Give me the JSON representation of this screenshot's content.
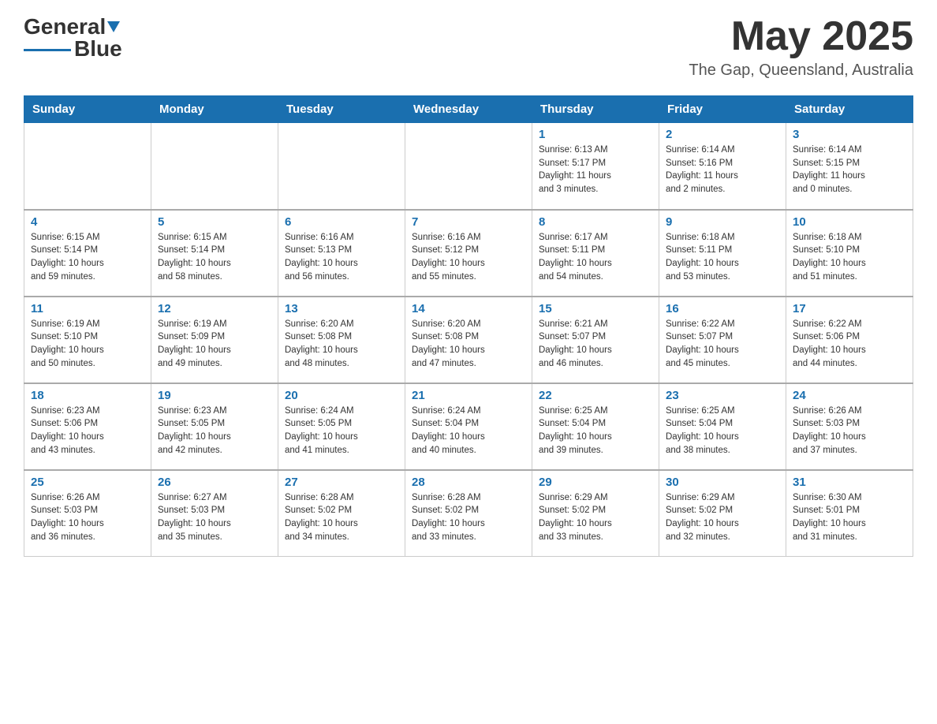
{
  "header": {
    "logo_text1": "General",
    "logo_text2": "Blue",
    "month": "May 2025",
    "location": "The Gap, Queensland, Australia"
  },
  "weekdays": [
    "Sunday",
    "Monday",
    "Tuesday",
    "Wednesday",
    "Thursday",
    "Friday",
    "Saturday"
  ],
  "weeks": [
    [
      {
        "day": "",
        "info": ""
      },
      {
        "day": "",
        "info": ""
      },
      {
        "day": "",
        "info": ""
      },
      {
        "day": "",
        "info": ""
      },
      {
        "day": "1",
        "info": "Sunrise: 6:13 AM\nSunset: 5:17 PM\nDaylight: 11 hours\nand 3 minutes."
      },
      {
        "day": "2",
        "info": "Sunrise: 6:14 AM\nSunset: 5:16 PM\nDaylight: 11 hours\nand 2 minutes."
      },
      {
        "day": "3",
        "info": "Sunrise: 6:14 AM\nSunset: 5:15 PM\nDaylight: 11 hours\nand 0 minutes."
      }
    ],
    [
      {
        "day": "4",
        "info": "Sunrise: 6:15 AM\nSunset: 5:14 PM\nDaylight: 10 hours\nand 59 minutes."
      },
      {
        "day": "5",
        "info": "Sunrise: 6:15 AM\nSunset: 5:14 PM\nDaylight: 10 hours\nand 58 minutes."
      },
      {
        "day": "6",
        "info": "Sunrise: 6:16 AM\nSunset: 5:13 PM\nDaylight: 10 hours\nand 56 minutes."
      },
      {
        "day": "7",
        "info": "Sunrise: 6:16 AM\nSunset: 5:12 PM\nDaylight: 10 hours\nand 55 minutes."
      },
      {
        "day": "8",
        "info": "Sunrise: 6:17 AM\nSunset: 5:11 PM\nDaylight: 10 hours\nand 54 minutes."
      },
      {
        "day": "9",
        "info": "Sunrise: 6:18 AM\nSunset: 5:11 PM\nDaylight: 10 hours\nand 53 minutes."
      },
      {
        "day": "10",
        "info": "Sunrise: 6:18 AM\nSunset: 5:10 PM\nDaylight: 10 hours\nand 51 minutes."
      }
    ],
    [
      {
        "day": "11",
        "info": "Sunrise: 6:19 AM\nSunset: 5:10 PM\nDaylight: 10 hours\nand 50 minutes."
      },
      {
        "day": "12",
        "info": "Sunrise: 6:19 AM\nSunset: 5:09 PM\nDaylight: 10 hours\nand 49 minutes."
      },
      {
        "day": "13",
        "info": "Sunrise: 6:20 AM\nSunset: 5:08 PM\nDaylight: 10 hours\nand 48 minutes."
      },
      {
        "day": "14",
        "info": "Sunrise: 6:20 AM\nSunset: 5:08 PM\nDaylight: 10 hours\nand 47 minutes."
      },
      {
        "day": "15",
        "info": "Sunrise: 6:21 AM\nSunset: 5:07 PM\nDaylight: 10 hours\nand 46 minutes."
      },
      {
        "day": "16",
        "info": "Sunrise: 6:22 AM\nSunset: 5:07 PM\nDaylight: 10 hours\nand 45 minutes."
      },
      {
        "day": "17",
        "info": "Sunrise: 6:22 AM\nSunset: 5:06 PM\nDaylight: 10 hours\nand 44 minutes."
      }
    ],
    [
      {
        "day": "18",
        "info": "Sunrise: 6:23 AM\nSunset: 5:06 PM\nDaylight: 10 hours\nand 43 minutes."
      },
      {
        "day": "19",
        "info": "Sunrise: 6:23 AM\nSunset: 5:05 PM\nDaylight: 10 hours\nand 42 minutes."
      },
      {
        "day": "20",
        "info": "Sunrise: 6:24 AM\nSunset: 5:05 PM\nDaylight: 10 hours\nand 41 minutes."
      },
      {
        "day": "21",
        "info": "Sunrise: 6:24 AM\nSunset: 5:04 PM\nDaylight: 10 hours\nand 40 minutes."
      },
      {
        "day": "22",
        "info": "Sunrise: 6:25 AM\nSunset: 5:04 PM\nDaylight: 10 hours\nand 39 minutes."
      },
      {
        "day": "23",
        "info": "Sunrise: 6:25 AM\nSunset: 5:04 PM\nDaylight: 10 hours\nand 38 minutes."
      },
      {
        "day": "24",
        "info": "Sunrise: 6:26 AM\nSunset: 5:03 PM\nDaylight: 10 hours\nand 37 minutes."
      }
    ],
    [
      {
        "day": "25",
        "info": "Sunrise: 6:26 AM\nSunset: 5:03 PM\nDaylight: 10 hours\nand 36 minutes."
      },
      {
        "day": "26",
        "info": "Sunrise: 6:27 AM\nSunset: 5:03 PM\nDaylight: 10 hours\nand 35 minutes."
      },
      {
        "day": "27",
        "info": "Sunrise: 6:28 AM\nSunset: 5:02 PM\nDaylight: 10 hours\nand 34 minutes."
      },
      {
        "day": "28",
        "info": "Sunrise: 6:28 AM\nSunset: 5:02 PM\nDaylight: 10 hours\nand 33 minutes."
      },
      {
        "day": "29",
        "info": "Sunrise: 6:29 AM\nSunset: 5:02 PM\nDaylight: 10 hours\nand 33 minutes."
      },
      {
        "day": "30",
        "info": "Sunrise: 6:29 AM\nSunset: 5:02 PM\nDaylight: 10 hours\nand 32 minutes."
      },
      {
        "day": "31",
        "info": "Sunrise: 6:30 AM\nSunset: 5:01 PM\nDaylight: 10 hours\nand 31 minutes."
      }
    ]
  ]
}
